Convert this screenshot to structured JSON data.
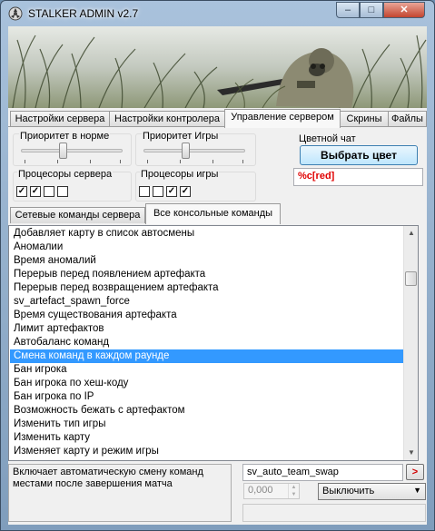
{
  "window": {
    "title": "STALKER ADMIN v2.7",
    "minimize_glyph": "–",
    "maximize_glyph": "□",
    "close_glyph": "✕"
  },
  "main_tabs": [
    {
      "label": "Настройки сервера"
    },
    {
      "label": "Настройки контролера"
    },
    {
      "label": "Управление сервером",
      "active": true
    },
    {
      "label": "Скрины"
    },
    {
      "label": "Файлы"
    }
  ],
  "priority": {
    "normal_label": "Приоритет в норме",
    "normal_level": 0.5,
    "game_label": "Приоритет Игры",
    "game_level": 0.5
  },
  "cpus": {
    "server_label": "Процесоры сервера",
    "server_checks": [
      true,
      true,
      false,
      false
    ],
    "game_label": "Процесоры игры",
    "game_checks": [
      false,
      false,
      true,
      true
    ]
  },
  "color_chat": {
    "label": "Цветной чат",
    "button_label": "Выбрать цвет",
    "value": "%c[red]",
    "accent": "#e00000"
  },
  "sub_tabs": [
    {
      "label": "Сетевые команды сервера"
    },
    {
      "label": "Все консольные команды",
      "active": true
    }
  ],
  "commands": [
    "Добавляет карту в список автосмены",
    "Аномалии",
    "Время аномалий",
    "Перерыв перед появлением артефакта",
    "Перерыв перед возвращением артефакта",
    "sv_artefact_spawn_force",
    "Время существования артефакта",
    "Лимит артефактов",
    "Автобаланс команд",
    "Смена команд в каждом раунде",
    "Бан игрока",
    "Бан игрока по хеш-коду",
    "Бан игрока по IP",
    "Возможность бежать с артефактом",
    "Изменить тип игры",
    "Изменить карту",
    "Изменяет карту и режим игры"
  ],
  "selected_index": 9,
  "selection_color": "#3399ff",
  "details": {
    "description": "Включает автоматическую смену команд местами после завершения матча",
    "command": "sv_auto_team_swap",
    "go_label": ">",
    "numeric_value": "0,000",
    "state_value": "Выключить"
  }
}
